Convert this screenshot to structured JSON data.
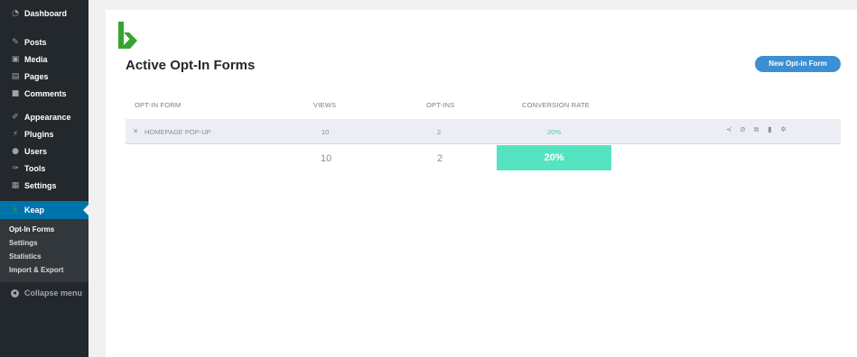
{
  "sidebar": {
    "items": [
      {
        "label": "Dashboard",
        "icon": "dashboard-icon"
      },
      {
        "label": "Posts",
        "icon": "pin-icon"
      },
      {
        "label": "Media",
        "icon": "media-icon"
      },
      {
        "label": "Pages",
        "icon": "pages-icon"
      },
      {
        "label": "Comments",
        "icon": "comments-icon"
      },
      {
        "label": "Appearance",
        "icon": "appearance-icon"
      },
      {
        "label": "Plugins",
        "icon": "plugins-icon"
      },
      {
        "label": "Users",
        "icon": "users-icon"
      },
      {
        "label": "Tools",
        "icon": "tools-icon"
      },
      {
        "label": "Settings",
        "icon": "settings-icon"
      },
      {
        "label": "Keap",
        "icon": "keap-icon"
      }
    ],
    "submenu": [
      "Opt-In Forms",
      "Settings",
      "Statistics",
      "Import & Export"
    ],
    "collapse": "Collapse menu"
  },
  "header": {
    "title": "Active Opt-In Forms",
    "new_button": "New Opt-in Form"
  },
  "table": {
    "columns": [
      "OPT-IN FORM",
      "VIEWS",
      "OPT-INS",
      "CONVERSION RATE"
    ],
    "rows": [
      {
        "name": "HOMEPAGE POP-UP",
        "views": "10",
        "optins": "2",
        "rate": "20%"
      }
    ],
    "totals": {
      "views": "10",
      "optins": "2",
      "rate": "20%"
    }
  },
  "colors": {
    "accent": "#3d8fd4",
    "keap_green": "#37a432",
    "rate_green": "#55e4c2",
    "sidebar": "#23282d",
    "active": "#0073aa"
  }
}
